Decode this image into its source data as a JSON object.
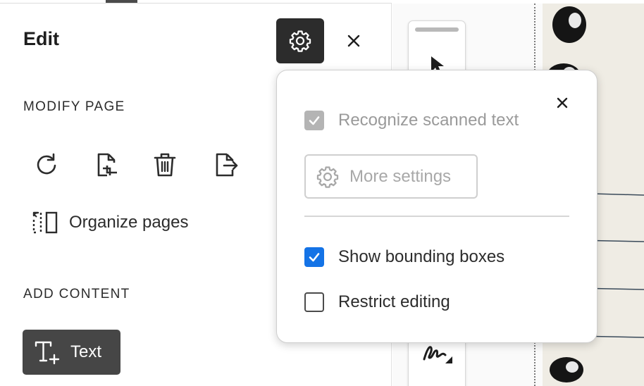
{
  "panel": {
    "title": "Edit",
    "settings_icon": "gear-icon",
    "close_icon": "close-icon",
    "sections": {
      "modify_page": "MODIFY PAGE",
      "add_content": "ADD CONTENT"
    },
    "modify_tools": [
      {
        "icon": "rotate-icon"
      },
      {
        "icon": "crop-page-icon"
      },
      {
        "icon": "delete-icon"
      },
      {
        "icon": "extract-page-icon"
      }
    ],
    "organize_label": "Organize pages",
    "organize_icon": "organize-pages-icon",
    "text_tool_label": "Text",
    "text_tool_icon": "add-text-icon"
  },
  "toolbar": {
    "tools": [
      {
        "icon": "pointer-icon"
      },
      {
        "icon": "sign-icon"
      }
    ]
  },
  "popover": {
    "close_icon": "close-icon",
    "recognize_label": "Recognize scanned text",
    "recognize_checked": true,
    "recognize_disabled": true,
    "more_settings_label": "More settings",
    "show_boxes_label": "Show bounding boxes",
    "show_boxes_checked": true,
    "restrict_label": "Restrict editing",
    "restrict_checked": false
  },
  "colors": {
    "accent": "#1473e6",
    "dark_button": "#2c2c2c",
    "text_tool_button": "#464646"
  }
}
